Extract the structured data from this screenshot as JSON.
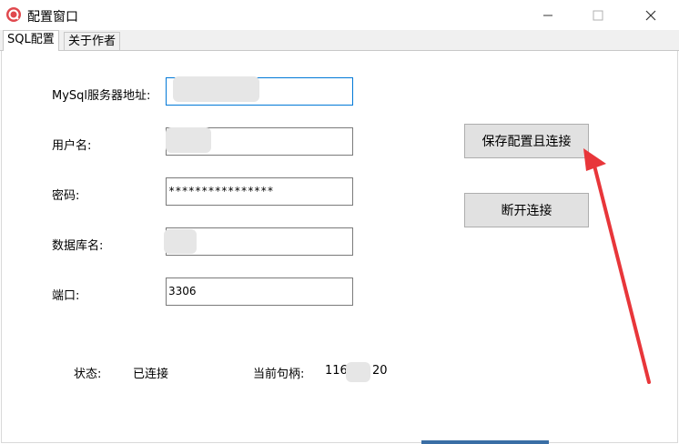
{
  "window": {
    "title": "配置窗口",
    "minimize_glyph": "—",
    "maximize_glyph": "☐",
    "close_glyph": "✕",
    "icon": "app-logo-icon"
  },
  "tabs": [
    {
      "label": "SQL配置"
    },
    {
      "label": "关于作者"
    }
  ],
  "form": {
    "host": {
      "label": "MySql服务器地址:",
      "value": ""
    },
    "user": {
      "label": "用户名:",
      "value": ""
    },
    "password": {
      "label": "密码:",
      "value": "****************"
    },
    "database": {
      "label": "数据库名:",
      "value": ""
    },
    "port": {
      "label": "端口:",
      "value": "3306"
    }
  },
  "buttons": {
    "save_connect": "保存配置且连接",
    "disconnect": "断开连接"
  },
  "status": {
    "label": "状态:",
    "value": "已连接",
    "handle_label": "当前句柄:",
    "handle_value_start": "116",
    "handle_value_end": "20"
  },
  "colors": {
    "accent": "#0078d7",
    "arrow": "#e8363a",
    "button_bg": "#e1e1e1",
    "app_icon": "#e0484d"
  }
}
